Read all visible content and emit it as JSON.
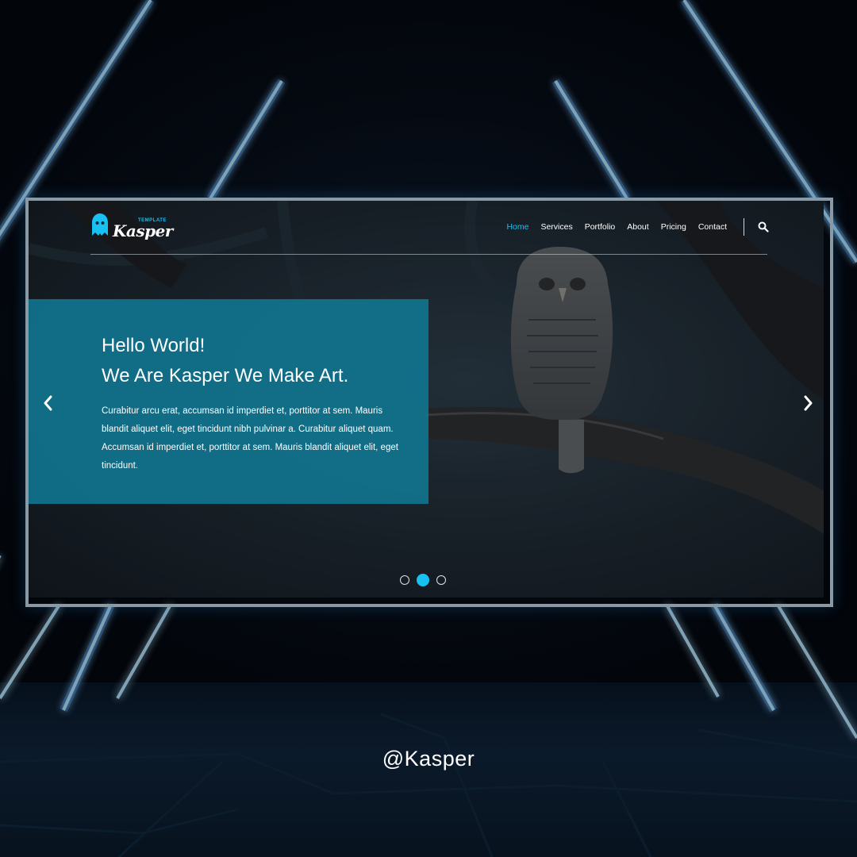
{
  "header": {
    "logo_tagline": "TEMPLATE",
    "logo_name": "Kasper",
    "nav": [
      {
        "label": "Home",
        "active": true
      },
      {
        "label": "Services",
        "active": false
      },
      {
        "label": "Portfolio",
        "active": false
      },
      {
        "label": "About",
        "active": false
      },
      {
        "label": "Pricing",
        "active": false
      },
      {
        "label": "Contact",
        "active": false
      }
    ],
    "search_icon": "search-icon"
  },
  "hero": {
    "title_line1": "Hello World!",
    "title_line2": "We Are Kasper We Make Art.",
    "text": "Curabitur arcu erat, accumsan id imperdiet et, porttitor at sem. Mauris blandit aliquet elit, eget tincidunt nibh pulvinar a. Curabitur aliquet quam. Accumsan id imperdiet et, porttitor at sem. Mauris blandit aliquet elit, eget tincidunt.",
    "prev_icon": "chevron-left-icon",
    "next_icon": "chevron-right-icon",
    "slides": 3,
    "active_slide": 2
  },
  "watermark": {
    "handle": "@Kasper"
  },
  "colors": {
    "accent": "#19c1f3",
    "caption_bg": "#117a96",
    "neon": "#2a8fe0"
  }
}
